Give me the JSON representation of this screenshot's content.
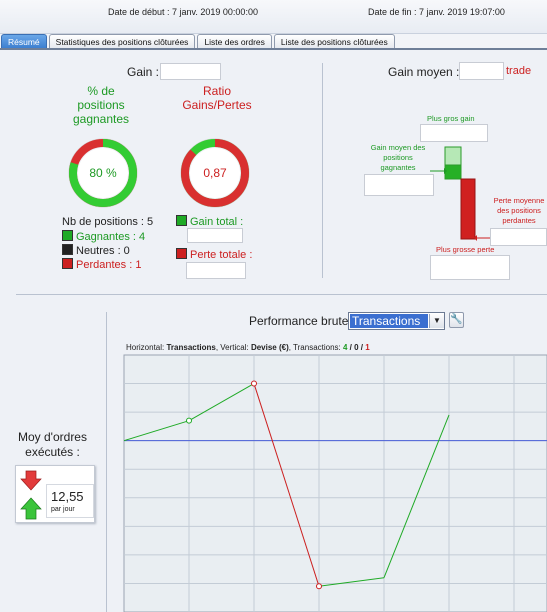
{
  "header": {
    "start_label": "Date de début : 7 janv. 2019 00:00:00",
    "end_label": "Date de fin : 7 janv. 2019 19:07:00"
  },
  "tabs": [
    {
      "label": "Résumé",
      "active": true
    },
    {
      "label": "Statistiques des positions clôturées",
      "active": false
    },
    {
      "label": "Liste des ordres",
      "active": false
    },
    {
      "label": "Liste des positions clôturées",
      "active": false
    }
  ],
  "left": {
    "gain_label": "Gain :",
    "gain_value": "",
    "win_pct_title": "% de positions gagnantes",
    "win_pct_value": "80 %",
    "ratio_title": "Ratio Gains/Pertes",
    "ratio_value": "0,87",
    "nb_positions": "Nb de positions : 5",
    "gagnantes": "Gagnantes : 4",
    "neutres": "Neutres : 0",
    "perdantes": "Perdantes : 1",
    "gain_total_label": "Gain total :",
    "perte_totale_label": "Perte totale :",
    "win_fraction": 0.8,
    "ratio_fraction": 0.87
  },
  "right": {
    "gain_moyen_label": "Gain moyen :",
    "gain_moyen_unit": "trade",
    "plus_gros_gain": "Plus gros gain",
    "gain_moyen_positions": "Gain moyen des positions gagnantes",
    "perte_moyenne_positions": "Perte moyenne des positions perdantes",
    "plus_grosse_perte": "Plus grosse perte"
  },
  "performance": {
    "label": "Performance brute",
    "select_value": "Transactions"
  },
  "orders": {
    "label": "Moy d'ordres exécutés :",
    "value": "12,55",
    "unit": "par jour"
  },
  "chart_info": {
    "prefix": "Horizontal: ",
    "h_value": "Transactions",
    "mid": ", Vertical: ",
    "v_value": "Devise (€)",
    "tx_label": ", Transactions: ",
    "tx_green": "4",
    "tx_sep1": " / ",
    "tx_black": "0",
    "tx_sep2": " / ",
    "tx_red": "1"
  },
  "colors": {
    "green": "#1faa26",
    "red": "#cc2020",
    "ring_green": "#33cc33",
    "ring_red": "#d93030",
    "baseline": "#4a5fd8"
  },
  "chart_data": {
    "type": "line",
    "x": [
      0,
      1,
      2,
      3,
      4,
      5
    ],
    "y": [
      0,
      0.7,
      2.0,
      -5.1,
      -4.8,
      0.9
    ],
    "segment_colors": [
      "green",
      "green",
      "red",
      "green",
      "green"
    ],
    "point_markers": [
      false,
      true,
      true,
      true,
      false,
      false
    ],
    "baseline_y": 0,
    "grid": true
  }
}
